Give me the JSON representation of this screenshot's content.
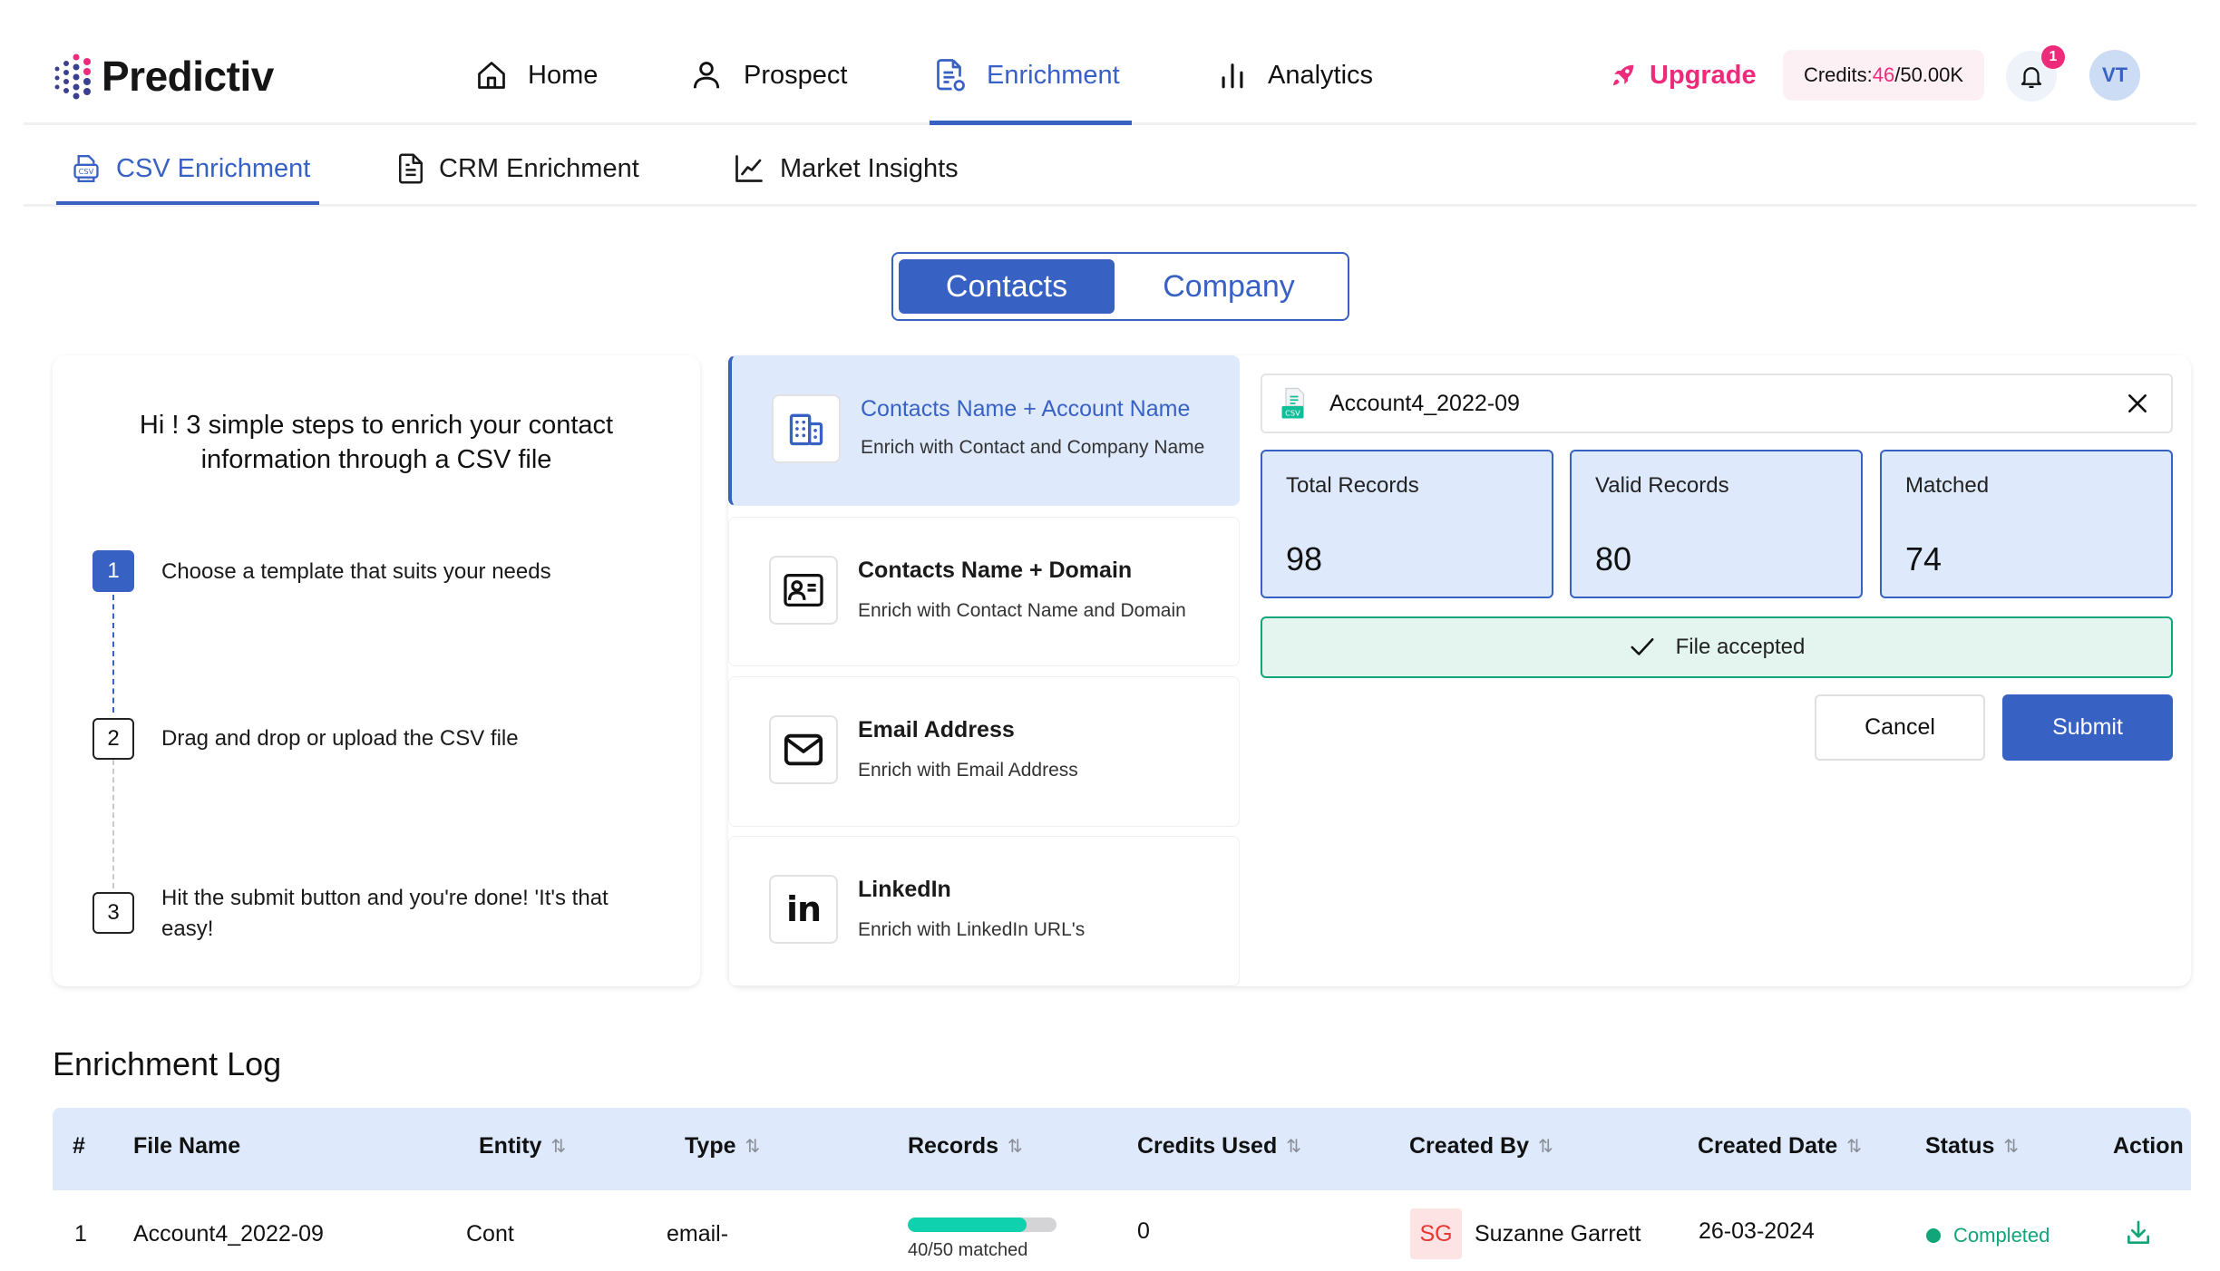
{
  "brand": {
    "name": "Predictiv"
  },
  "nav": {
    "items": [
      {
        "label": "Home",
        "icon": "home-icon",
        "active": false
      },
      {
        "label": "Prospect",
        "icon": "user-icon",
        "active": false
      },
      {
        "label": "Enrichment",
        "icon": "enrichment-doc-icon",
        "active": true
      },
      {
        "label": "Analytics",
        "icon": "bar-chart-icon",
        "active": false
      }
    ],
    "upgrade_label": "Upgrade",
    "credits": {
      "prefix": "Credits:",
      "used": "46",
      "total": "/50.00K"
    },
    "notifications_count": "1",
    "avatar_initials": "VT"
  },
  "subtabs": [
    {
      "label": "CSV Enrichment",
      "icon": "csv-file-icon",
      "active": true
    },
    {
      "label": "CRM Enrichment",
      "icon": "document-icon",
      "active": false
    },
    {
      "label": "Market Insights",
      "icon": "line-chart-icon",
      "active": false
    }
  ],
  "entity_toggle": {
    "options": [
      "Contacts",
      "Company"
    ],
    "selected": "Contacts"
  },
  "steps": {
    "title": "Hi ! 3 simple steps to enrich your contact information through a CSV file",
    "items": [
      {
        "num": "1",
        "text": "Choose a template that suits your needs",
        "active": true
      },
      {
        "num": "2",
        "text": "Drag and drop or upload the CSV file",
        "active": false
      },
      {
        "num": "3",
        "text": "Hit the submit button and you're done! 'It's that easy!",
        "active": false
      }
    ]
  },
  "templates": [
    {
      "title": "Contacts Name + Account Name",
      "description": "Enrich with Contact and Company Name",
      "icon": "building-icon",
      "selected": true
    },
    {
      "title": "Contacts Name + Domain",
      "description": "Enrich with Contact Name and Domain",
      "icon": "contact-card-icon",
      "selected": false
    },
    {
      "title": "Email Address",
      "description": "Enrich with Email Address",
      "icon": "mail-icon",
      "selected": false
    },
    {
      "title": "LinkedIn",
      "description": "Enrich with LinkedIn URL's",
      "icon": "linkedin-icon",
      "selected": false
    }
  ],
  "upload": {
    "file_name": "Account4_2022-09",
    "stats": [
      {
        "label": "Total Records",
        "value": "98"
      },
      {
        "label": "Valid Records",
        "value": "80"
      },
      {
        "label": "Matched",
        "value": "74"
      }
    ],
    "status_message": "File accepted",
    "cancel_label": "Cancel",
    "submit_label": "Submit"
  },
  "log": {
    "title": "Enrichment Log",
    "columns": [
      "#",
      "File Name",
      "Entity",
      "Type",
      "Records",
      "Credits Used",
      "Created By",
      "Created Date",
      "Status",
      "Action"
    ],
    "rows": [
      {
        "index": "1",
        "file_name": "Account4_2022-09",
        "entity": "Cont",
        "type": "email-",
        "records_matched": 40,
        "records_total": 50,
        "records_label": "40/50 matched",
        "credits_used": "0",
        "created_by_initials": "SG",
        "created_by": "Suzanne Garrett",
        "created_date": "26-03-2024",
        "status": "Completed"
      }
    ]
  },
  "colors": {
    "primary": "#3861c4",
    "accent": "#ee2a7b",
    "success": "#12a57a",
    "selected_bg": "#deeafc",
    "progress": "#0fd1ad"
  }
}
